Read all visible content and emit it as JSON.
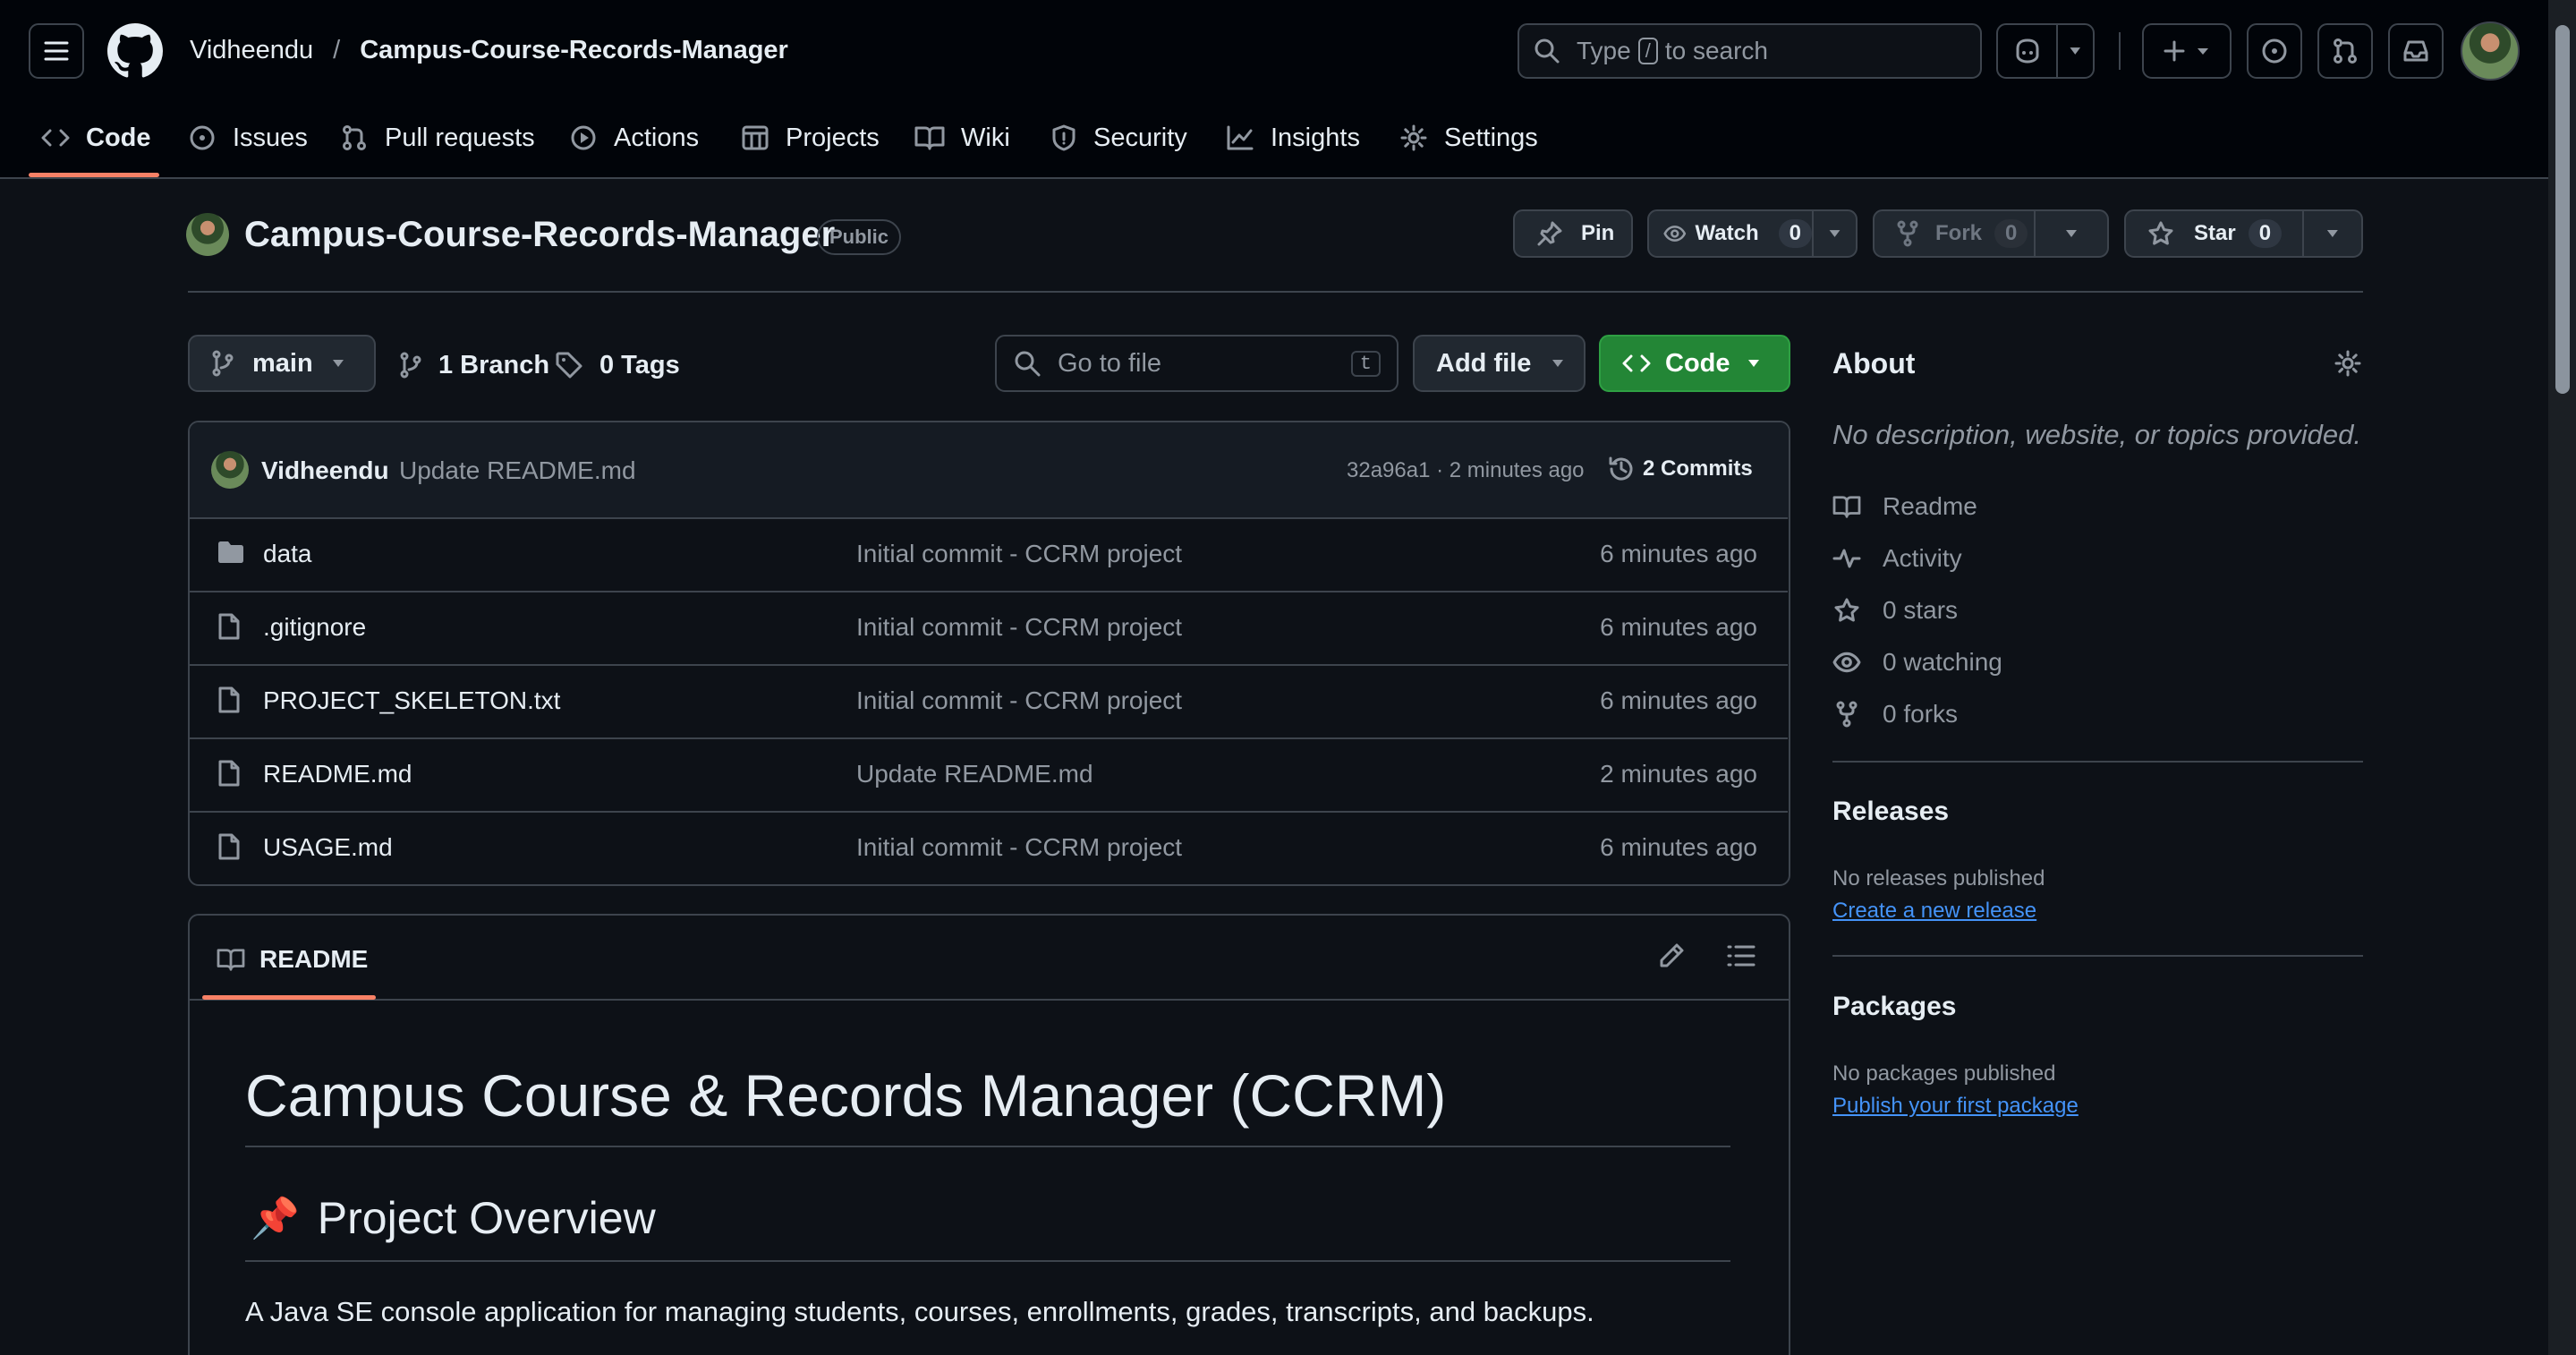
{
  "header": {
    "owner": "Vidheendu",
    "separator": "/",
    "repo": "Campus-Course-Records-Manager",
    "search_prefix": "Type",
    "search_key": "/",
    "search_suffix": "to search"
  },
  "tabs": [
    {
      "label": "Code",
      "icon": "code-icon",
      "selected": true
    },
    {
      "label": "Issues",
      "icon": "issue-icon"
    },
    {
      "label": "Pull requests",
      "icon": "pull-request-icon"
    },
    {
      "label": "Actions",
      "icon": "play-icon"
    },
    {
      "label": "Projects",
      "icon": "table-icon"
    },
    {
      "label": "Wiki",
      "icon": "book-icon"
    },
    {
      "label": "Security",
      "icon": "shield-icon"
    },
    {
      "label": "Insights",
      "icon": "graph-icon"
    },
    {
      "label": "Settings",
      "icon": "gear-icon"
    }
  ],
  "repo": {
    "title": "Campus-Course-Records-Manager",
    "visibility": "Public",
    "pin_label": "Pin",
    "watch_label": "Watch",
    "watch_count": "0",
    "fork_label": "Fork",
    "fork_count": "0",
    "star_label": "Star",
    "star_count": "0"
  },
  "toolbar": {
    "branch": "main",
    "branch_count": "1 Branch",
    "tag_count": "0 Tags",
    "goto_placeholder": "Go to file",
    "goto_key": "t",
    "add_file": "Add file",
    "code": "Code"
  },
  "commit": {
    "author": "Vidheendu",
    "message": "Update README.md",
    "sha_time": "32a96a1 · 2 minutes ago",
    "commits": "2 Commits"
  },
  "files": [
    {
      "name": "data",
      "type": "folder",
      "message": "Initial commit - CCRM project",
      "time": "6 minutes ago"
    },
    {
      "name": ".gitignore",
      "type": "file",
      "message": "Initial commit - CCRM project",
      "time": "6 minutes ago"
    },
    {
      "name": "PROJECT_SKELETON.txt",
      "type": "file",
      "message": "Initial commit - CCRM project",
      "time": "6 minutes ago"
    },
    {
      "name": "README.md",
      "type": "file",
      "message": "Update README.md",
      "time": "2 minutes ago"
    },
    {
      "name": "USAGE.md",
      "type": "file",
      "message": "Initial commit - CCRM project",
      "time": "6 minutes ago"
    }
  ],
  "readme": {
    "tab_label": "README",
    "h1": "Campus Course & Records Manager (CCRM)",
    "h2_emoji": "📌",
    "h2": "Project Overview",
    "paragraph": "A Java SE console application for managing students, courses, enrollments, grades, transcripts, and backups."
  },
  "about": {
    "title": "About",
    "description": "No description, website, or topics provided.",
    "items": [
      {
        "label": "Readme",
        "icon": "book-icon"
      },
      {
        "label": "Activity",
        "icon": "pulse-icon"
      },
      {
        "label": "0 stars",
        "icon": "star-icon"
      },
      {
        "label": "0 watching",
        "icon": "eye-icon"
      },
      {
        "label": "0 forks",
        "icon": "fork-icon"
      }
    ]
  },
  "releases": {
    "title": "Releases",
    "none_text": "No releases published",
    "create_link": "Create a new release"
  },
  "packages": {
    "title": "Packages",
    "none_text": "No packages published",
    "publish_link": "Publish your first package"
  },
  "colors": {
    "accent_underline": "#f78166",
    "code_button": "#238636",
    "link": "#4493f8"
  }
}
